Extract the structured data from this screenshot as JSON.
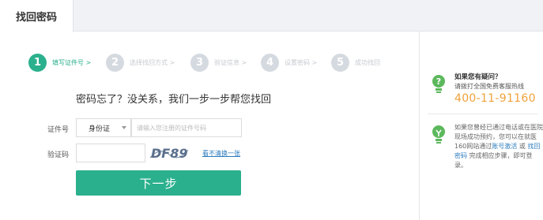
{
  "tabs": {
    "active_label": "找回密码"
  },
  "steps": [
    {
      "number": "1",
      "label": "填写证件号 >"
    },
    {
      "number": "2",
      "label": "选择找回方式 >"
    },
    {
      "number": "3",
      "label": "验证信息 >"
    },
    {
      "number": "4",
      "label": "设置密码 >"
    },
    {
      "number": "5",
      "label": "成功找回"
    }
  ],
  "main": {
    "headline": "密码忘了？没关系，我们一步一步帮您找回",
    "id_label": "证件号",
    "id_type_value": "身份证",
    "id_placeholder": "请输入您注册的证件号码",
    "code_label": "验证码",
    "code_value": "",
    "captcha_text": "DF89",
    "refresh_label": "看不清换一张",
    "next_label": "下一步"
  },
  "sidebar": {
    "help_title": "如果您有疑问？",
    "help_sub": "请拨打全国免费客服热线",
    "hotline": "400-11-91160",
    "note_part1": "如果您曾经已通过电话或在医院现场成功预约，您可以在就医160网站通过",
    "note_link1": "账号激活",
    "note_or": " 或 ",
    "note_link2": "找回密码",
    "note_part2": " 完成相应步骤，即可登录。"
  },
  "colors": {
    "accent_green": "#2bb08d",
    "hotline_orange": "#f0a23b",
    "link_blue": "#2b7bbd",
    "inactive_step": "#d5dae0"
  },
  "icons": {
    "help": "question-bulb-icon",
    "tip": "lightbulb-icon",
    "select_caret": "chevron-down-icon"
  }
}
